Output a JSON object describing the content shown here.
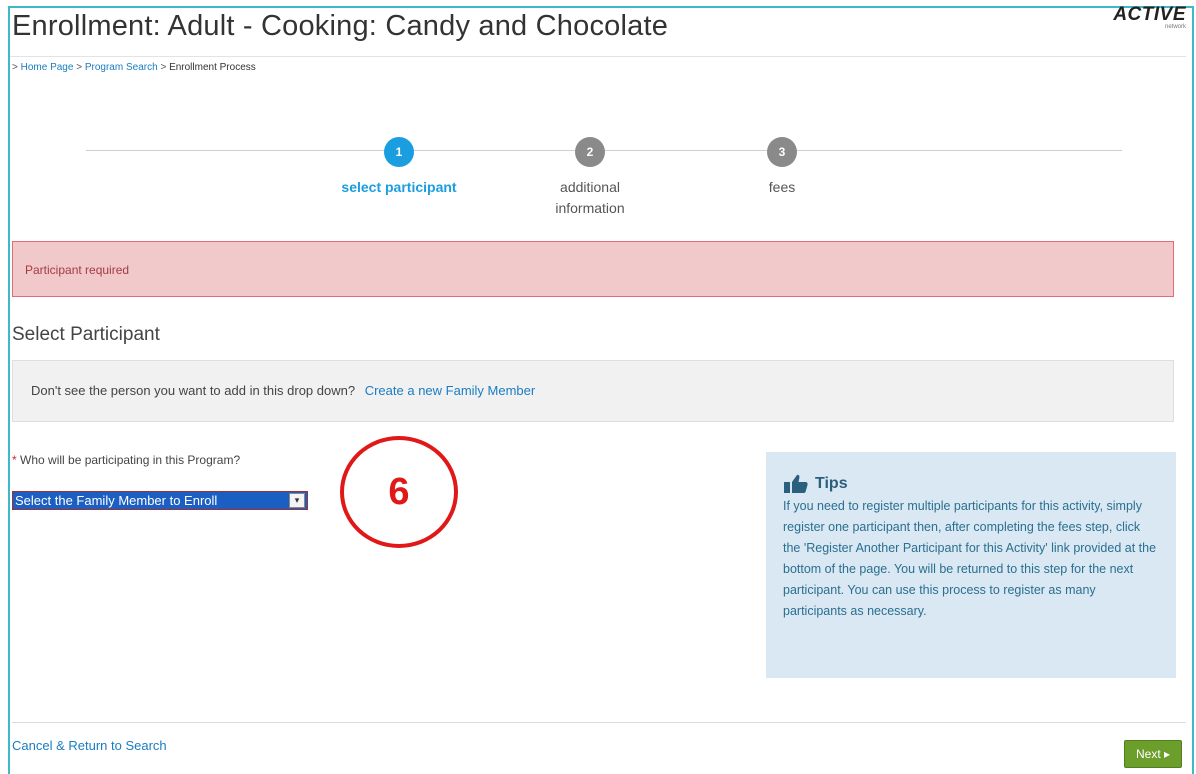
{
  "header": {
    "title": "Enrollment: Adult - Cooking: Candy and Chocolate",
    "logo_text": "ACTIVE",
    "logo_sub": "network"
  },
  "breadcrumb": {
    "prefix": ">",
    "items": [
      "Home Page",
      "Program Search",
      "Enrollment Process"
    ],
    "separator": ">"
  },
  "steps": [
    {
      "number": "1",
      "label": "select participant",
      "active": true
    },
    {
      "number": "2",
      "label_line1": "additional",
      "label_line2": "information",
      "active": false
    },
    {
      "number": "3",
      "label": "fees",
      "active": false
    }
  ],
  "alert": {
    "text": "Participant required"
  },
  "participant": {
    "section_title": "Select Participant",
    "info_text": "Don't see the person you want to add in this drop down?",
    "create_link": "Create a new Family Member",
    "required_mark": "*",
    "question": "Who will be participating in this Program?",
    "select_value": "Select the Family Member to Enroll",
    "caret": "▾"
  },
  "annotation": {
    "number": "6"
  },
  "tips": {
    "title": "Tips",
    "body": "If you need to register multiple participants for this activity, simply register one participant then, after completing the fees step, click the 'Register Another Participant for this Activity' link provided at the bottom of the page. You will be returned to this step for the next participant. You can use this process to register as many participants as necessary."
  },
  "footer": {
    "cancel_link": "Cancel & Return to Search",
    "next_label": "Next ▸"
  },
  "colors": {
    "accent": "#1a9ee0",
    "link": "#1a7dc2",
    "alert_bg": "#f2c9cb",
    "tips_bg": "#d9e8f2",
    "next_button": "#6c9e2c",
    "annotation": "#e11818"
  }
}
